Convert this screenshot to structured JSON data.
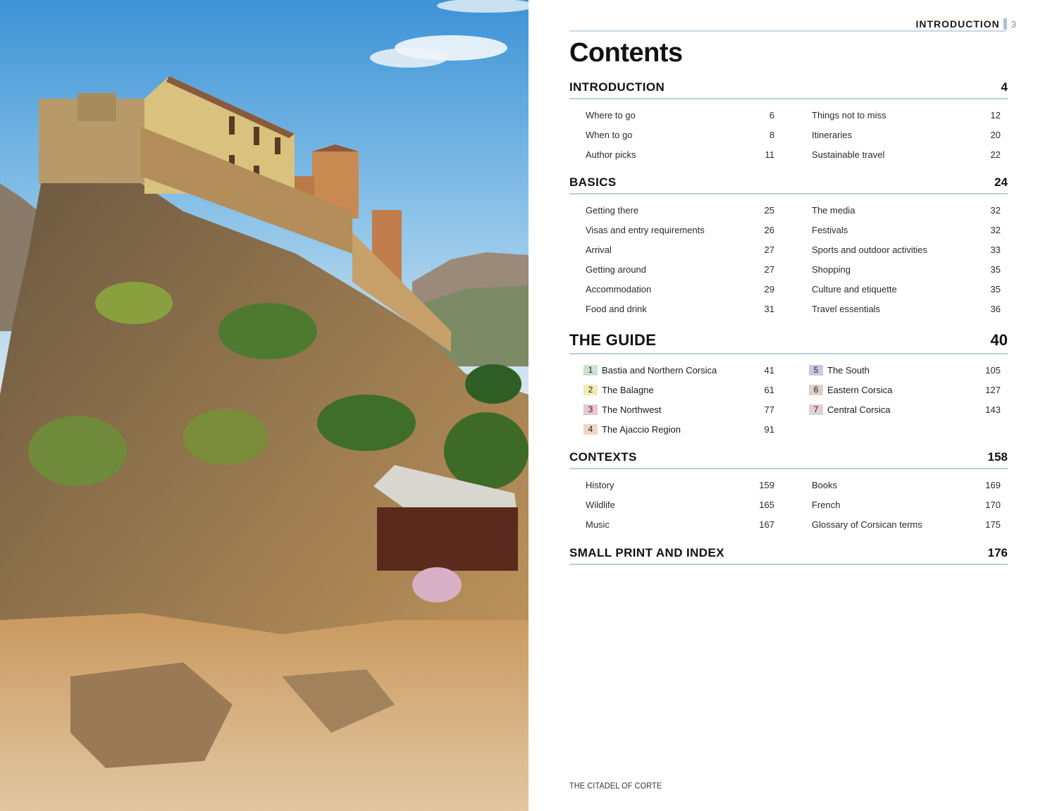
{
  "running_head": {
    "label": "INTRODUCTION",
    "page": "3"
  },
  "title": "Contents",
  "sections": {
    "introduction": {
      "title": "INTRODUCTION",
      "page": "4",
      "left": [
        {
          "label": "Where to go",
          "page": "6"
        },
        {
          "label": "When to go",
          "page": "8"
        },
        {
          "label": "Author picks",
          "page": "11"
        }
      ],
      "right": [
        {
          "label": "Things not to miss",
          "page": "12"
        },
        {
          "label": "Itineraries",
          "page": "20"
        },
        {
          "label": "Sustainable travel",
          "page": "22"
        }
      ]
    },
    "basics": {
      "title": "BASICS",
      "page": "24",
      "left": [
        {
          "label": "Getting there",
          "page": "25"
        },
        {
          "label": "Visas and entry requirements",
          "page": "26"
        },
        {
          "label": "Arrival",
          "page": "27"
        },
        {
          "label": "Getting around",
          "page": "27"
        },
        {
          "label": "Accommodation",
          "page": "29"
        },
        {
          "label": "Food and drink",
          "page": "31"
        }
      ],
      "right": [
        {
          "label": "The media",
          "page": "32"
        },
        {
          "label": "Festivals",
          "page": "32"
        },
        {
          "label": "Sports and outdoor activities",
          "page": "33"
        },
        {
          "label": "Shopping",
          "page": "35"
        },
        {
          "label": "Culture and etiquette",
          "page": "35"
        },
        {
          "label": "Travel essentials",
          "page": "36"
        }
      ]
    },
    "guide": {
      "title": "THE GUIDE",
      "page": "40",
      "left": [
        {
          "num": "1",
          "label": "Bastia and Northern Corsica",
          "page": "41",
          "color": "#cfe0cf"
        },
        {
          "num": "2",
          "label": "The Balagne",
          "page": "61",
          "color": "#f3ebb4"
        },
        {
          "num": "3",
          "label": "The Northwest",
          "page": "77",
          "color": "#e8c4d6"
        },
        {
          "num": "4",
          "label": "The Ajaccio Region",
          "page": "91",
          "color": "#f1d5c2"
        }
      ],
      "right": [
        {
          "num": "5",
          "label": "The South",
          "page": "105",
          "color": "#c9c8e2"
        },
        {
          "num": "6",
          "label": "Eastern Corsica",
          "page": "127",
          "color": "#ddd0c6"
        },
        {
          "num": "7",
          "label": "Central Corsica",
          "page": "143",
          "color": "#e3cdd6"
        }
      ]
    },
    "contexts": {
      "title": "CONTEXTS",
      "page": "158",
      "left": [
        {
          "label": "History",
          "page": "159"
        },
        {
          "label": "Wildlife",
          "page": "165"
        },
        {
          "label": "Music",
          "page": "167"
        }
      ],
      "right": [
        {
          "label": "Books",
          "page": "169"
        },
        {
          "label": "French",
          "page": "170"
        },
        {
          "label": "Glossary of Corsican terms",
          "page": "175"
        }
      ]
    },
    "small_print": {
      "title": "SMALL PRINT AND INDEX",
      "page": "176"
    }
  },
  "caption": "THE CITADEL OF CORTE"
}
